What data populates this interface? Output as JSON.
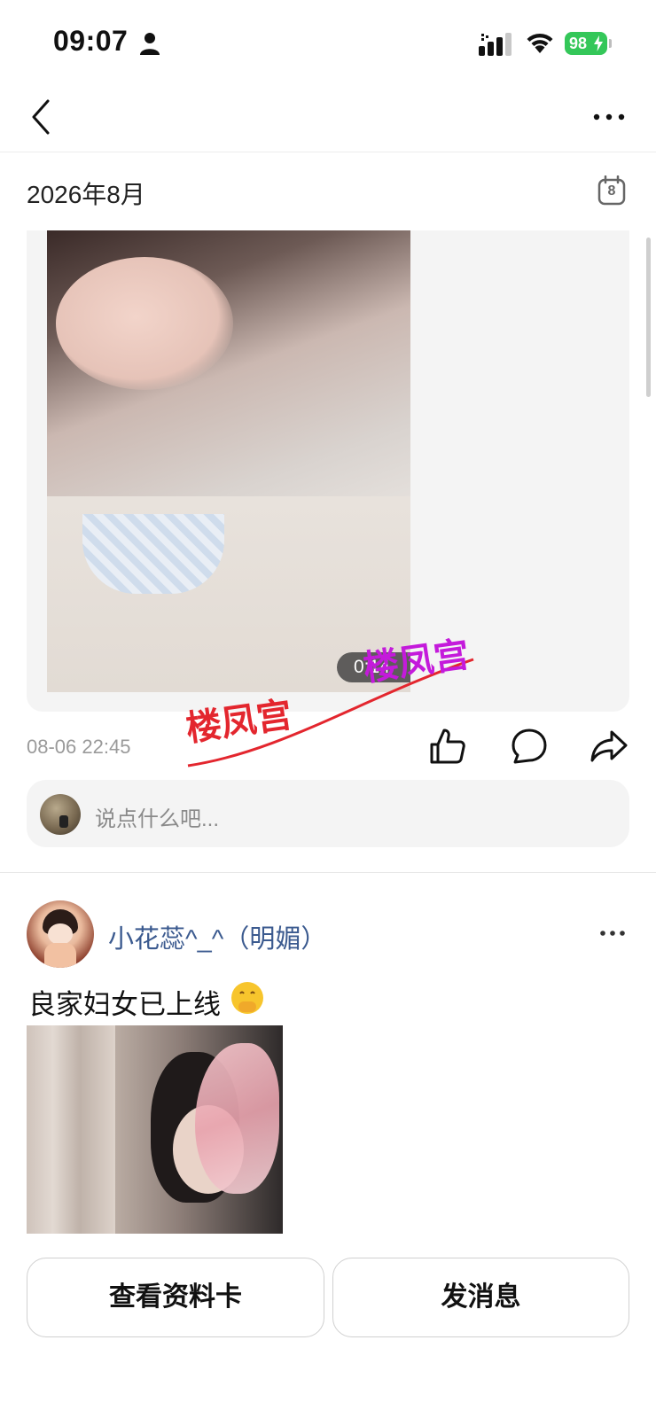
{
  "status_bar": {
    "time": "09:07",
    "battery": "98",
    "icons": [
      "person-icon",
      "signal-icon",
      "wifi-icon",
      "battery-icon"
    ]
  },
  "nav": {
    "back_icon": "chevron-left-icon",
    "more_icon": "more-horizontal-icon"
  },
  "month_header": {
    "title": "2026年8月",
    "calendar_day": "8"
  },
  "media_post": {
    "video_duration": "0:14",
    "watermark_text": "楼凤宫",
    "timestamp": "08-06 22:45",
    "actions": [
      "like-icon",
      "comment-icon",
      "share-icon"
    ]
  },
  "comment": {
    "placeholder": "说点什么吧..."
  },
  "next_post": {
    "author": "小花蕊^_^（明媚）",
    "text": "良家妇女已上线",
    "emoji": "🤭"
  },
  "buttons": {
    "profile": "查看资料卡",
    "message": "发消息"
  },
  "colors": {
    "battery_green": "#34c759",
    "author_blue": "#3b5a8f",
    "watermark_red": "#e3262e",
    "watermark_purple": "#c41adb"
  }
}
